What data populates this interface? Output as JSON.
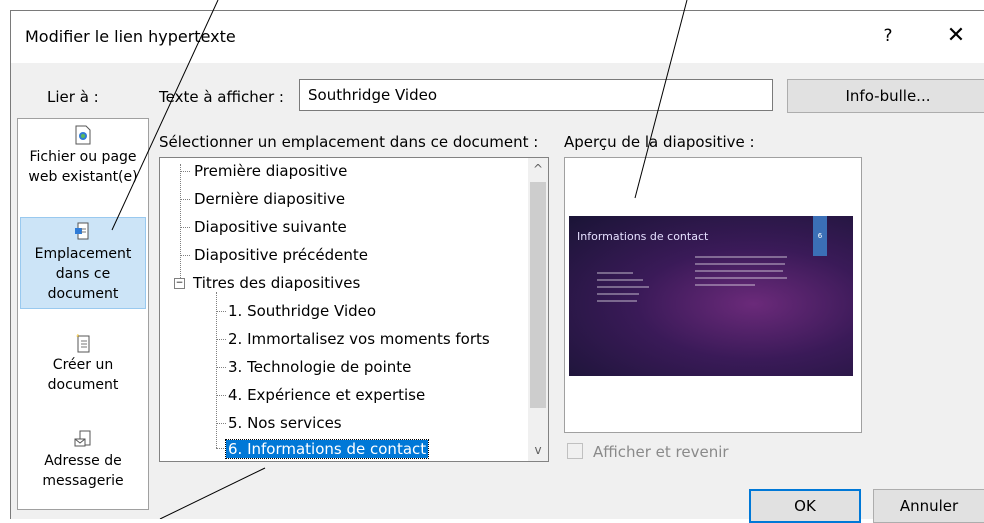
{
  "dialog": {
    "title": "Modifier le lien hypertexte",
    "help": "?",
    "close": "✕"
  },
  "link_to": {
    "label": "Lier à :",
    "items": [
      {
        "label": "Fichier ou page web existant(e)",
        "icon": "file-web-icon",
        "selected": false
      },
      {
        "label": "Emplacement dans ce document",
        "icon": "document-place-icon",
        "selected": true
      },
      {
        "label": "Créer un document",
        "icon": "new-document-icon",
        "selected": false
      },
      {
        "label": "Adresse de messagerie",
        "icon": "email-icon",
        "selected": false
      }
    ]
  },
  "text_display": {
    "label": "Texte à afficher :",
    "value": "Southridge Video"
  },
  "tooltip_button": "Info-bulle...",
  "select_location": {
    "label": "Sélectionner un emplacement dans ce document :",
    "tree": [
      {
        "label": "Première diapositive",
        "level": 0
      },
      {
        "label": "Dernière diapositive",
        "level": 0
      },
      {
        "label": "Diapositive suivante",
        "level": 0
      },
      {
        "label": "Diapositive précédente",
        "level": 0
      },
      {
        "label": "Titres des diapositives",
        "level": 0,
        "expander": "−"
      },
      {
        "label": "1. Southridge Video",
        "level": 1
      },
      {
        "label": "2. Immortalisez vos moments forts",
        "level": 1
      },
      {
        "label": "3. Technologie de pointe",
        "level": 1
      },
      {
        "label": "4. Expérience et expertise",
        "level": 1
      },
      {
        "label": "5. Nos services",
        "level": 1
      },
      {
        "label": "6. Informations de contact",
        "level": 1,
        "selected": true
      }
    ],
    "scroll_up": "^",
    "scroll_down": "v"
  },
  "preview": {
    "label": "Aperçu de la diapositive :",
    "slide_title": "Informations de contact",
    "slide_number": "6"
  },
  "show_and_return": {
    "label": "Afficher et revenir",
    "checked": false,
    "enabled": false
  },
  "buttons": {
    "ok": "OK",
    "cancel": "Annuler"
  }
}
